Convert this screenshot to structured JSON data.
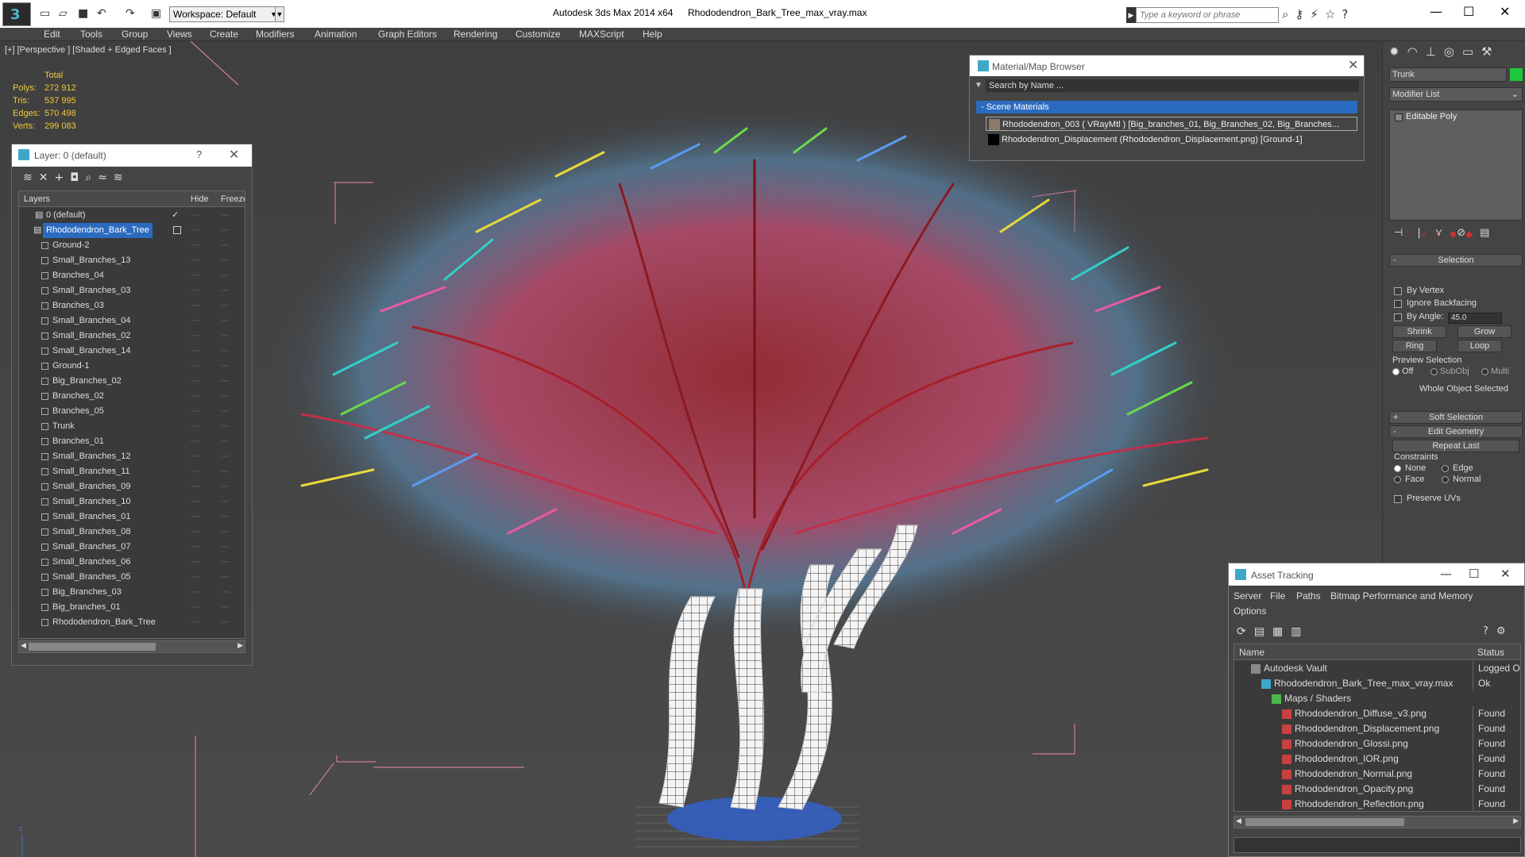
{
  "titlebar": {
    "workspace": "Workspace: Default",
    "app_title": "Autodesk 3ds Max  2014 x64",
    "file_title": "Rhododendron_Bark_Tree_max_vray.max",
    "search_placeholder": "Type a keyword or phrase"
  },
  "menu": [
    "Edit",
    "Tools",
    "Group",
    "Views",
    "Create",
    "Modifiers",
    "Animation",
    "Graph Editors",
    "Rendering",
    "Customize",
    "MAXScript",
    "Help"
  ],
  "viewport": {
    "label": "[+] [Perspective ] [Shaded + Edged Faces ]",
    "stats": {
      "header": "Total",
      "rows": [
        {
          "label": "Polys:",
          "value": "272 912"
        },
        {
          "label": "Tris:",
          "value": "537 995"
        },
        {
          "label": "Edges:",
          "value": "570 498"
        },
        {
          "label": "Verts:",
          "value": "299 083"
        }
      ]
    }
  },
  "layer_panel": {
    "title": "Layer: 0 (default)",
    "help": "?",
    "columns": {
      "layers": "Layers",
      "hide": "Hide",
      "freeze": "Freeze"
    },
    "rows": [
      "0 (default)",
      "Rhododendron_Bark_Tree",
      "Ground-2",
      "Small_Branches_13",
      "Branches_04",
      "Small_Branches_03",
      "Branches_03",
      "Small_Branches_04",
      "Small_Branches_02",
      "Small_Branches_14",
      "Ground-1",
      "Big_Branches_02",
      "Branches_02",
      "Branches_05",
      "Trunk",
      "Branches_01",
      "Small_Branches_12",
      "Small_Branches_11",
      "Small_Branches_09",
      "Small_Branches_10",
      "Small_Branches_01",
      "Small_Branches_08",
      "Small_Branches_07",
      "Small_Branches_06",
      "Small_Branches_05",
      "Big_Branches_03",
      "Big_branches_01",
      "Rhododendron_Bark_Tree"
    ]
  },
  "material_browser": {
    "title": "Material/Map Browser",
    "search": "Search by Name ...",
    "section": "- Scene Materials",
    "items": [
      {
        "label": "Rhododendron_003  ( VRayMtl ) [Big_branches_01, Big_Branches_02, Big_Branches...",
        "color": "#8a7a6a"
      },
      {
        "label": "Rhododendron_Displacement (Rhododendron_Displacement.png) [Ground-1]",
        "color": "#000000"
      }
    ]
  },
  "command_panel": {
    "object_name": "Trunk",
    "object_color": "#1ec83c",
    "modifier_list": "Modifier List",
    "stack_item": "Editable Poly",
    "selection": {
      "title": "Selection",
      "by_vertex": "By Vertex",
      "ignore_backfacing": "Ignore Backfacing",
      "by_angle": "By Angle:",
      "angle_value": "45.0",
      "shrink": "Shrink",
      "grow": "Grow",
      "ring": "Ring",
      "loop": "Loop",
      "preview_selection": "Preview Selection",
      "off": "Off",
      "subobj": "SubObj",
      "multi": "Multi",
      "status": "Whole Object Selected"
    },
    "soft_selection": "Soft Selection",
    "edit_geometry": "Edit Geometry",
    "repeat_last": "Repeat Last",
    "constraints": "Constraints",
    "none": "None",
    "edge": "Edge",
    "face": "Face",
    "normal": "Normal",
    "preserve_uvs": "Preserve UVs"
  },
  "asset_tracking": {
    "title": "Asset Tracking",
    "menu": [
      "Server",
      "File",
      "Paths",
      "Bitmap Performance and Memory",
      "Options"
    ],
    "columns": {
      "name": "Name",
      "status": "Status"
    },
    "rows": [
      {
        "name": "Autodesk Vault",
        "status": "Logged O",
        "indent": 1
      },
      {
        "name": "Rhododendron_Bark_Tree_max_vray.max",
        "status": "Ok",
        "indent": 2
      },
      {
        "name": "Maps / Shaders",
        "status": "",
        "indent": 3
      },
      {
        "name": "Rhododendron_Diffuse_v3.png",
        "status": "Found",
        "indent": 4
      },
      {
        "name": "Rhododendron_Displacement.png",
        "status": "Found",
        "indent": 4
      },
      {
        "name": "Rhododendron_Glossi.png",
        "status": "Found",
        "indent": 4
      },
      {
        "name": "Rhododendron_IOR.png",
        "status": "Found",
        "indent": 4
      },
      {
        "name": "Rhododendron_Normal.png",
        "status": "Found",
        "indent": 4
      },
      {
        "name": "Rhododendron_Opacity.png",
        "status": "Found",
        "indent": 4
      },
      {
        "name": "Rhododendron_Reflection.png",
        "status": "Found",
        "indent": 4
      }
    ]
  }
}
